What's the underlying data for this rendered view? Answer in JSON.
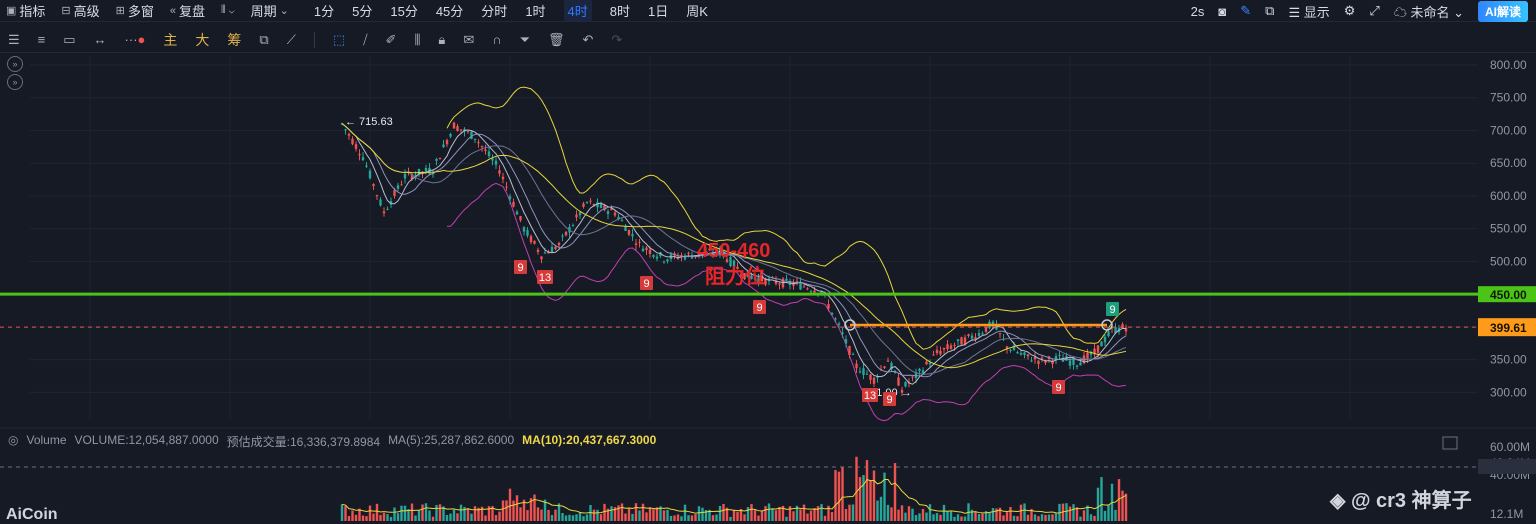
{
  "topbar": {
    "indicator": "指标",
    "advanced": "高级",
    "multi_window": "多窗",
    "replay": "复盘",
    "period_label": "周期",
    "periods": [
      "1分",
      "5分",
      "15分",
      "45分",
      "分时",
      "1时",
      "4时",
      "8时",
      "1日",
      "周K"
    ],
    "active_period": "4时",
    "refresh": "2s",
    "display": "显示",
    "unnamed": "未命名",
    "ai": "AI解读"
  },
  "drawbar": {
    "cn_tools": [
      "主",
      "大",
      "筹"
    ]
  },
  "chart": {
    "price_axis": [
      "800.00",
      "750.00",
      "700.00",
      "650.00",
      "600.00",
      "550.00",
      "500.00",
      "450.00",
      "400.00",
      "350.00",
      "300.00"
    ],
    "resistance_level": "450.00",
    "current_price": "399.61",
    "high_label": "← 715.63",
    "low_label": "301.00 →",
    "annotation_line1": "450-460",
    "annotation_line2": "阻力位",
    "td_labels": [
      "9",
      "13",
      "9",
      "9",
      "9",
      "13",
      "9",
      "9"
    ],
    "colors": {
      "up": "#26a69a",
      "down": "#ef5350",
      "green_line": "#4cc417",
      "orange": "#ff9b1a",
      "yellow": "#e8d63a",
      "pink": "#c23fb0"
    }
  },
  "volume": {
    "title": "Volume",
    "volume": "VOLUME:12,054,887.0000",
    "estimate": "预估成交量:16,336,379.8984",
    "ma5": "MA(5):25,287,862.6000",
    "ma10": "MA(10):20,437,667.3000",
    "axis": [
      "60.00M",
      "48.34M",
      "40.00M",
      "12.1M"
    ]
  },
  "watermark": {
    "brand": "AiCoin",
    "author": "cr3 神算子"
  }
}
